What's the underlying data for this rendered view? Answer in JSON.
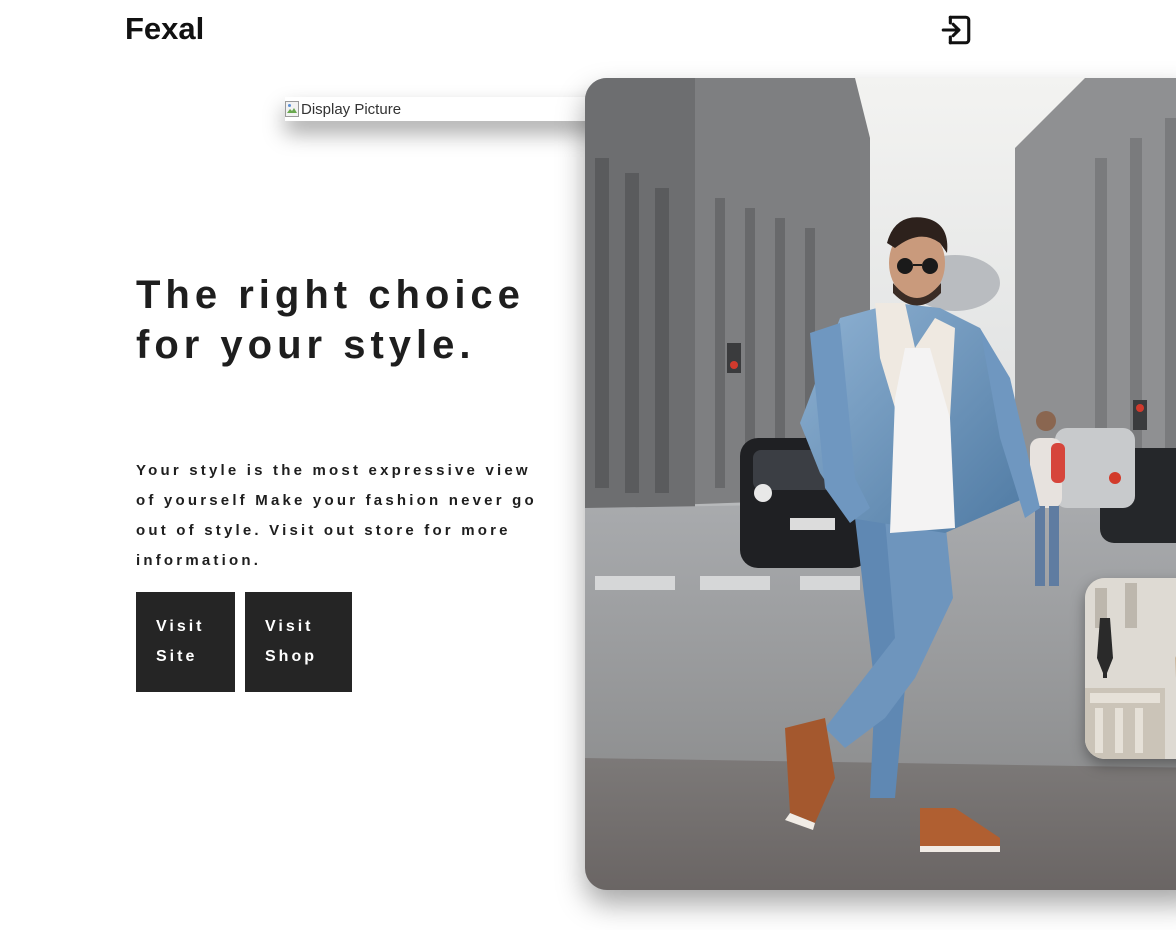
{
  "header": {
    "brand": "Fexal",
    "login_icon": "login-icon"
  },
  "display_picture": {
    "alt": "Display Picture",
    "icon": "broken-image-icon"
  },
  "hero": {
    "title": "The right choice for your style.",
    "description": "Your style is the most expressive view of yourself Make your fashion never go out of style. Visit out store for more information.",
    "buttons": {
      "visit_site": "Visit Site",
      "visit_shop": "Visit Shop"
    }
  },
  "colors": {
    "button_bg": "#252525",
    "text": "#1e1e1e",
    "background": "#ffffff"
  }
}
